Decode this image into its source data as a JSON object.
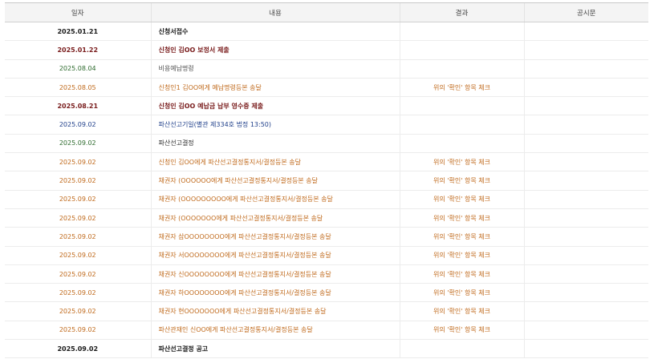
{
  "table": {
    "headers": [
      "일자",
      "내용",
      "결과",
      "공시문"
    ],
    "rows": [
      {
        "date": "2025.01.21",
        "content": "신청서접수",
        "result": "",
        "notice": "",
        "style": "black"
      },
      {
        "date": "2025.01.22",
        "content": "신청인 김OO 보정서 제출",
        "result": "",
        "notice": "",
        "style": "maroon"
      },
      {
        "date": "2025.08.04",
        "content": "비용예납명령",
        "result": "",
        "notice": "",
        "style": "green"
      },
      {
        "date": "2025.08.05",
        "content": "신청인1 김OO에게 예납명령등본 송달",
        "result": "위의 '확인' 항목 체크",
        "notice": "",
        "style": "orange"
      },
      {
        "date": "2025.08.21",
        "content": "신청인 김OO 예납금 납부 영수증 제출",
        "result": "",
        "notice": "",
        "style": "maroon"
      },
      {
        "date": "2025.09.02",
        "content": "파산선고기일(별관 제334호 법정 13:50)",
        "result": "",
        "notice": "",
        "style": "blue"
      },
      {
        "date": "2025.09.02",
        "content": "파산선고결정",
        "result": "",
        "notice": "",
        "style": "greenbold"
      },
      {
        "date": "2025.09.02",
        "content": "신청인 김OO에게 파산선고결정통지서/결정등본 송달",
        "result": "위의 '확인' 항목 체크",
        "notice": "",
        "style": "orange"
      },
      {
        "date": "2025.09.02",
        "content": "채권자 (OOOOOO에게 파산선고결정통지서/결정등본 송달",
        "result": "위의 '확인' 항목 체크",
        "notice": "",
        "style": "orange"
      },
      {
        "date": "2025.09.02",
        "content": "채권자 (OOOOOOOOO에게 파산선고결정통지서/결정등본 송달",
        "result": "위의 '확인' 항목 체크",
        "notice": "",
        "style": "orange"
      },
      {
        "date": "2025.09.02",
        "content": "채권자 (OOOOOOO에게 파산선고결정통지서/결정등본 송달",
        "result": "위의 '확인' 항목 체크",
        "notice": "",
        "style": "orange"
      },
      {
        "date": "2025.09.02",
        "content": "채권자 삼OOOOOOOO에게 파산선고결정통지서/결정등본 송달",
        "result": "위의 '확인' 항목 체크",
        "notice": "",
        "style": "orange"
      },
      {
        "date": "2025.09.02",
        "content": "채권자 서OOOOOOOO에게 파산선고결정통지서/결정등본 송달",
        "result": "위의 '확인' 항목 체크",
        "notice": "",
        "style": "orange"
      },
      {
        "date": "2025.09.02",
        "content": "채권자 신OOOOOOOO에게 파산선고결정통지서/결정등본 송달",
        "result": "위의 '확인' 항목 체크",
        "notice": "",
        "style": "orange"
      },
      {
        "date": "2025.09.02",
        "content": "채권자 하OOOOOOOO에게 파산선고결정통지서/결정등본 송달",
        "result": "위의 '확인' 항목 체크",
        "notice": "",
        "style": "orange"
      },
      {
        "date": "2025.09.02",
        "content": "채권자 현OOOOOOO에게 파산선고결정통지서/결정등본 송달",
        "result": "위의 '확인' 항목 체크",
        "notice": "",
        "style": "orange"
      },
      {
        "date": "2025.09.02",
        "content": "파산관재인 신OO에게 파산선고결정통지서/결정등본 송달",
        "result": "위의 '확인' 항목 체크",
        "notice": "",
        "style": "orange"
      },
      {
        "date": "2025.09.02",
        "content": "파산선고결정 공고",
        "result": "",
        "notice": "",
        "style": "black"
      }
    ]
  }
}
